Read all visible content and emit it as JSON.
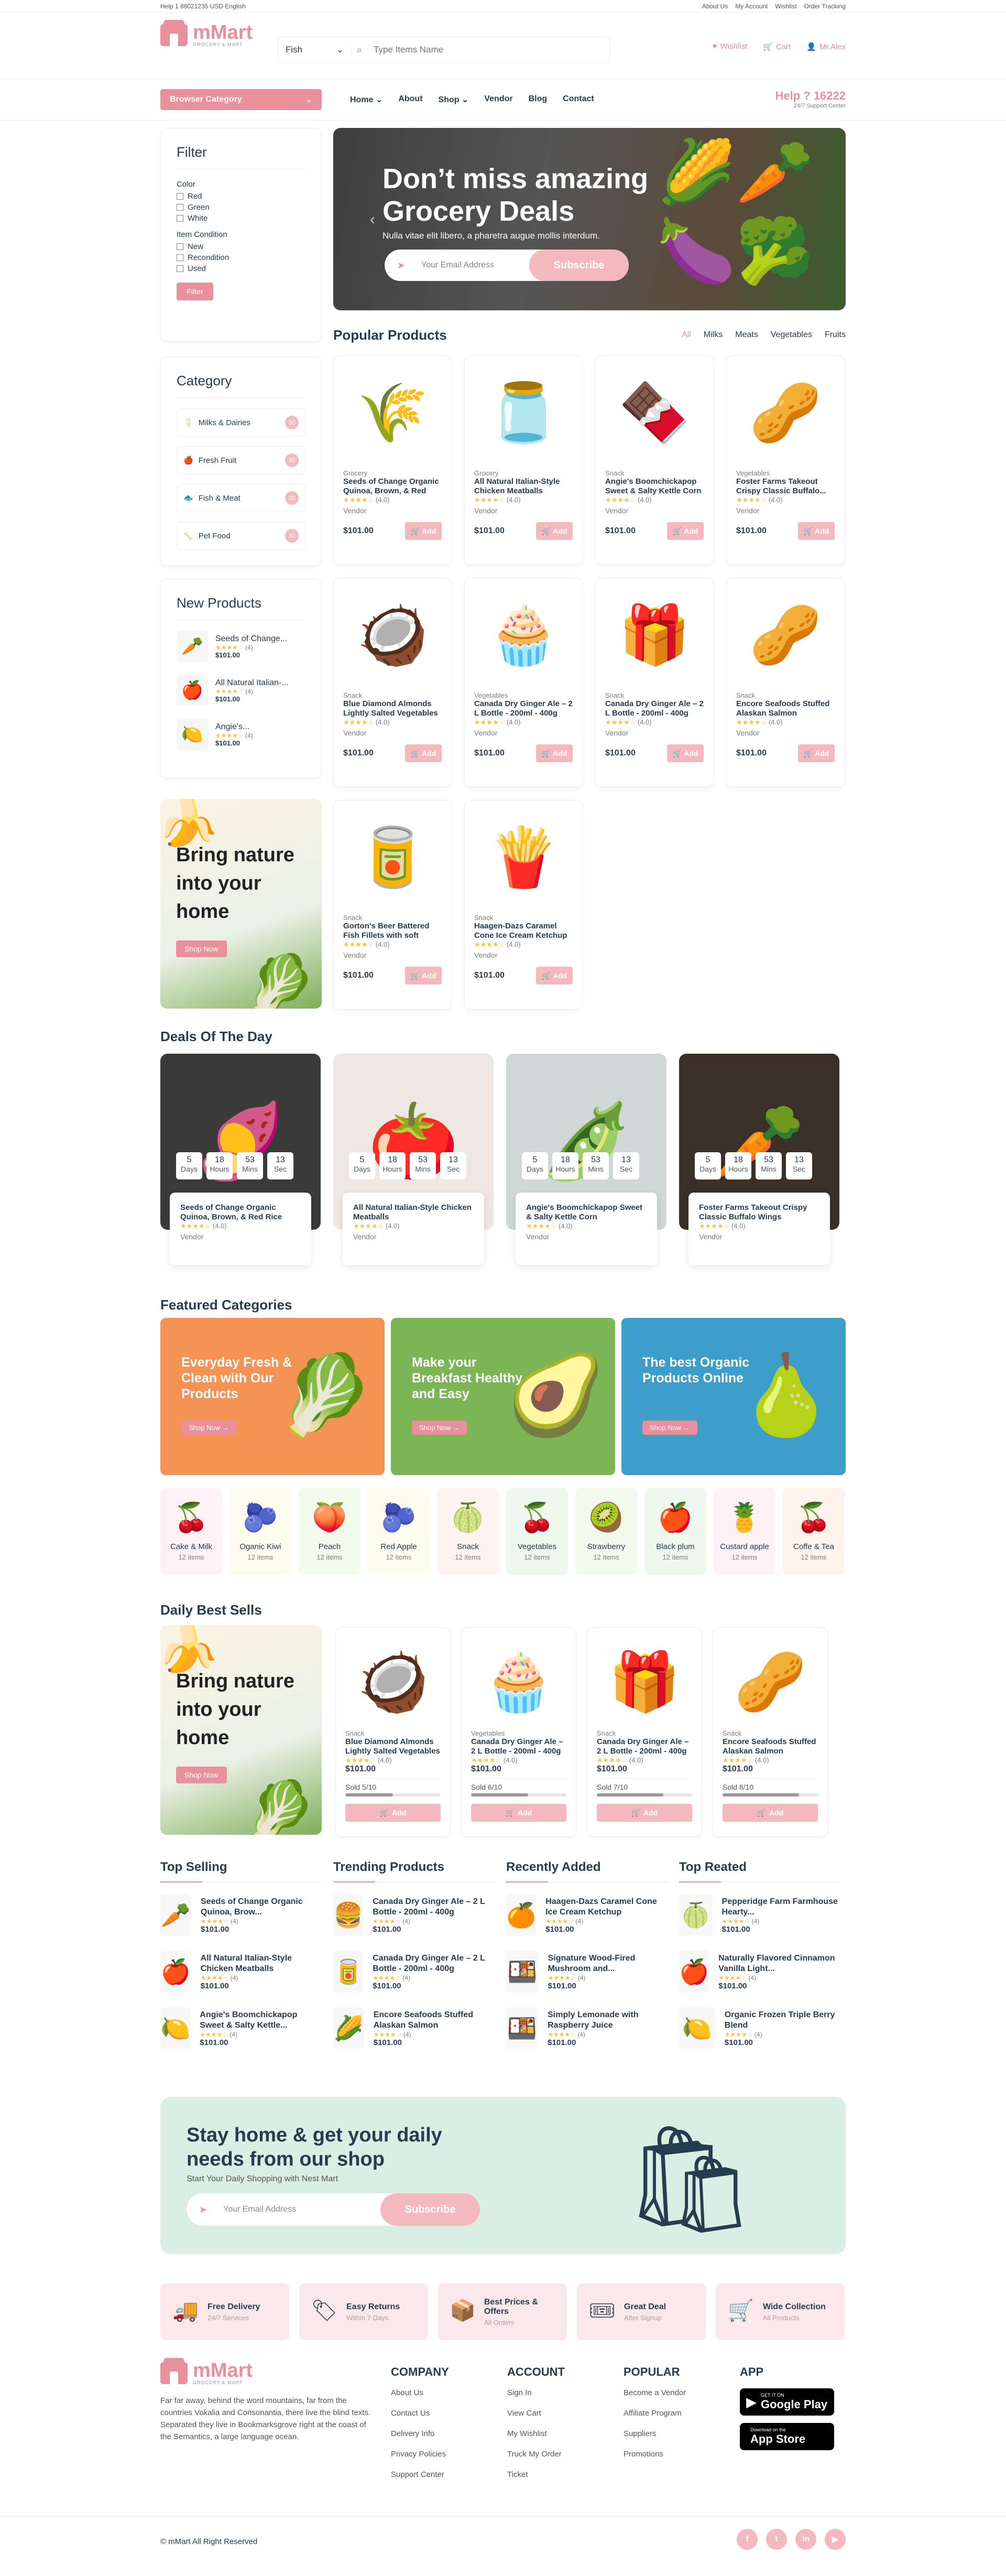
{
  "topbar": {
    "left": "Help 1 88021235  USD  English",
    "links": [
      "About Us",
      "My Account",
      "Wishlist",
      "Order Tracking"
    ]
  },
  "header": {
    "logo": "mMart",
    "logo_sub": "GROCERY & MART",
    "search_cat": "Fish",
    "search_placeholder": "Type Items Name",
    "wishlist": "Wishlist",
    "cart": "Cart",
    "account": "Mr.Alex"
  },
  "nav": {
    "browse": "Browser Category",
    "items": [
      "Home",
      "About",
      "Shop",
      "Vendor",
      "Blog",
      "Contact"
    ],
    "help_num": "Help ? 16222",
    "help_sub": "24/7 Support Center"
  },
  "filter": {
    "title": "Filter",
    "color_label": "Color",
    "colors": [
      "Red",
      "Green",
      "White"
    ],
    "cond_label": "Item Condition",
    "conds": [
      "New",
      "Recondition",
      "Used"
    ],
    "btn": "Filter"
  },
  "category": {
    "title": "Category",
    "items": [
      {
        "name": "Milks & Dairies",
        "count": "30",
        "icon": "🥛"
      },
      {
        "name": "Fresh Fruit",
        "count": "30",
        "icon": "🍎"
      },
      {
        "name": "Fish & Meat",
        "count": "30",
        "icon": "🐟"
      },
      {
        "name": "Pet Food",
        "count": "30",
        "icon": "🦴"
      }
    ]
  },
  "newp": {
    "title": "New Products",
    "items": [
      {
        "name": "Seeds of Change...",
        "rating": "(4)",
        "price": "$101.00",
        "icon": "🥕"
      },
      {
        "name": "All Natural Italian-...",
        "rating": "(4)",
        "price": "$101.00",
        "icon": "🍎"
      },
      {
        "name": "Angie's...",
        "rating": "(4)",
        "price": "$101.00",
        "icon": "🍋"
      }
    ]
  },
  "bannerL": {
    "title": "Bring nature into your home",
    "btn": "Shop Now"
  },
  "hero": {
    "title": "Don’t miss amazing Grocery Deals",
    "sub": "Nulla vitae elit libero, a pharetra augue mollis interdum.",
    "placeholder": "Your Email Address",
    "btn": "Subscribe"
  },
  "popular": {
    "title": "Popular Products",
    "tabs": [
      "All",
      "Milks",
      "Meats",
      "Vegetables",
      "Fruits"
    ],
    "items": [
      {
        "cat": "Grocery",
        "name": "Seeds of Change Organic Quinoa, Brown, & Red Rice",
        "rating": "(4.0)",
        "vendor": "Vendor",
        "price": "$101.00",
        "icon": "🌾"
      },
      {
        "cat": "Grocery",
        "name": "All Natural Italian-Style Chicken Meatballs",
        "rating": "(4.0)",
        "vendor": "Vendor",
        "price": "$101.00",
        "icon": "🫙"
      },
      {
        "cat": "Snack",
        "name": "Angie's Boomchickapop Sweet & Salty Kettle Corn",
        "rating": "(4.0)",
        "vendor": "Vendor",
        "price": "$101.00",
        "icon": "🍫"
      },
      {
        "cat": "Vegetables",
        "name": "Foster Farms Takeout Crispy Classic Buffalo...",
        "rating": "(4.0)",
        "vendor": "Vendor",
        "price": "$101.00",
        "icon": "🥜"
      },
      {
        "cat": "Snack",
        "name": "Blue Diamond Almonds Lightly Salted Vegetables",
        "rating": "(4.0)",
        "vendor": "Vendor",
        "price": "$101.00",
        "icon": "🥥"
      },
      {
        "cat": "Vegetables",
        "name": "Canada Dry Ginger Ale – 2 L Bottle - 200ml - 400g",
        "rating": "(4.0)",
        "vendor": "Vendor",
        "price": "$101.00",
        "icon": "🧁"
      },
      {
        "cat": "Snack",
        "name": "Canada Dry Ginger Ale – 2 L Bottle - 200ml - 400g",
        "rating": "(4.0)",
        "vendor": "Vendor",
        "price": "$101.00",
        "icon": "🎁"
      },
      {
        "cat": "Snack",
        "name": "Encore Seafoods Stuffed Alaskan Salmon",
        "rating": "(4.0)",
        "vendor": "Vendor",
        "price": "$101.00",
        "icon": "🥜"
      },
      {
        "cat": "Snack",
        "name": "Gorton's Beer Battered Fish Fillets with soft paper",
        "rating": "(4.0)",
        "vendor": "Vendor",
        "price": "$101.00",
        "icon": "🥫"
      },
      {
        "cat": "Snack",
        "name": "Haagen-Dazs Caramel Cone Ice Cream Ketchup",
        "rating": "(4.0)",
        "vendor": "Vendor",
        "price": "$101.00",
        "icon": "🍟"
      }
    ],
    "add": "Add"
  },
  "deals": {
    "title": "Deals Of The Day",
    "timer": [
      {
        "v": "5",
        "u": "Days"
      },
      {
        "v": "18",
        "u": "Hours"
      },
      {
        "v": "53",
        "u": "Mins"
      },
      {
        "v": "13",
        "u": "Sec"
      }
    ],
    "items": [
      {
        "name": "Seeds of Change Organic Quinoa, Brown, & Red Rice",
        "rating": "(4.0)",
        "vendor": "Vendor",
        "icon": "🍠",
        "bg": "#3a3a3a"
      },
      {
        "name": "All Natural Italian-Style Chicken Meatballs",
        "rating": "(4.0)",
        "vendor": "Vendor",
        "icon": "🍅",
        "bg": "#eee7e2"
      },
      {
        "name": "Angie's Boomchickapop Sweet & Salty Kettle Corn",
        "rating": "(4.0)",
        "vendor": "Vendor",
        "icon": "🫛",
        "bg": "#cfd8d6"
      },
      {
        "name": "Foster Farms Takeout Crispy Classic Buffalo Wings",
        "rating": "(4.0)",
        "vendor": "Vendor",
        "icon": "🥕",
        "bg": "#3b3028"
      }
    ]
  },
  "featured": {
    "title": "Featured Categories",
    "banners": [
      {
        "title": "Everyday Fresh & Clean with Our Products",
        "btn": "Shop Now →",
        "bg": "#f49353",
        "icon": "🥬"
      },
      {
        "title": "Make your Breakfast Healthy and Easy",
        "btn": "Shop Now →",
        "bg": "#7bb555",
        "icon": "🥑"
      },
      {
        "title": "The best Organic Products Online",
        "btn": "Shop Now →",
        "bg": "#3d9ec9",
        "icon": "🍐"
      }
    ],
    "cats": [
      {
        "n": "Cake & Milk",
        "c": "12 items",
        "e": "🍒",
        "bg": "#fdf1f6"
      },
      {
        "n": "Oganic Kiwi",
        "c": "12 items",
        "e": "🫐",
        "bg": "#fdfbee"
      },
      {
        "n": "Peach",
        "c": "12 items",
        "e": "🍑",
        "bg": "#f2fbec"
      },
      {
        "n": "Red Apple",
        "c": "12 items",
        "e": "🫐",
        "bg": "#fefbef"
      },
      {
        "n": "Snack",
        "c": "12 items",
        "e": "🍈",
        "bg": "#fdf3f0"
      },
      {
        "n": "Vegetables",
        "c": "12 items",
        "e": "🍒",
        "bg": "#eef8ee"
      },
      {
        "n": "Strawberry",
        "c": "12 items",
        "e": "🥝",
        "bg": "#f2faec"
      },
      {
        "n": "Black plum",
        "c": "12 items",
        "e": "🍎",
        "bg": "#eef8ee"
      },
      {
        "n": "Custard apple",
        "c": "12 items",
        "e": "🍍",
        "bg": "#fdf1f6"
      },
      {
        "n": "Coffe & Tea",
        "c": "12 items",
        "e": "🍒",
        "bg": "#fef3ea"
      }
    ]
  },
  "daily": {
    "title": "Daily Best Sells",
    "banner_title": "Bring nature into your home",
    "banner_btn": "Shop Now",
    "items": [
      {
        "cat": "Snack",
        "name": "Blue Diamond Almonds Lightly Salted Vegetables",
        "rating": "(4.0)",
        "price": "$101.00",
        "sold": "Sold 5/10",
        "pct": 0.5,
        "icon": "🥥"
      },
      {
        "cat": "Vegetables",
        "name": "Canada Dry Ginger Ale – 2 L Bottle - 200ml - 400g",
        "rating": "(4.0)",
        "price": "$101.00",
        "sold": "Sold 6/10",
        "pct": 0.6,
        "icon": "🧁"
      },
      {
        "cat": "Snack",
        "name": "Canada Dry Ginger Ale – 2 L Bottle - 200ml - 400g",
        "rating": "(4.0)",
        "price": "$101.00",
        "sold": "Sold 7/10",
        "pct": 0.7,
        "icon": "🎁"
      },
      {
        "cat": "Snack",
        "name": "Encore Seafoods Stuffed Alaskan Salmon",
        "rating": "(4.0)",
        "price": "$101.00",
        "sold": "Sold 8/10",
        "pct": 0.8,
        "icon": "🥜"
      }
    ],
    "add": "Add"
  },
  "lists": [
    {
      "title": "Top Selling",
      "items": [
        {
          "name": "Seeds of Change Organic Quinoa, Brow...",
          "r": "(4)",
          "p": "$101.00",
          "e": "🥕"
        },
        {
          "name": "All Natural Italian-Style Chicken Meatballs",
          "r": "(4)",
          "p": "$101.00",
          "e": "🍎"
        },
        {
          "name": "Angie's Boomchickapop Sweet & Salty Kettle...",
          "r": "(4)",
          "p": "$101.00",
          "e": "🍋"
        }
      ]
    },
    {
      "title": "Trending Products",
      "items": [
        {
          "name": "Canada Dry Ginger Ale – 2 L Bottle - 200ml - 400g",
          "r": "(4)",
          "p": "$101.00",
          "e": "🍔"
        },
        {
          "name": "Canada Dry Ginger Ale – 2 L Bottle - 200ml - 400g",
          "r": "(4)",
          "p": "$101.00",
          "e": "🥫"
        },
        {
          "name": "Encore Seafoods Stuffed Alaskan Salmon",
          "r": "(4)",
          "p": "$101.00",
          "e": "🌽"
        }
      ]
    },
    {
      "title": "Recently Added",
      "items": [
        {
          "name": "Haagen-Dazs Caramel Cone Ice Cream Ketchup",
          "r": "(4)",
          "p": "$101.00",
          "e": "🍊"
        },
        {
          "name": "Signature Wood-Fired Mushroom and...",
          "r": "(4)",
          "p": "$101.00",
          "e": "🍱"
        },
        {
          "name": "Simply Lemonade with Raspberry Juice",
          "r": "(4)",
          "p": "$101.00",
          "e": "🍱"
        }
      ]
    },
    {
      "title": "Top Reated",
      "items": [
        {
          "name": "Pepperidge Farm Farmhouse Hearty...",
          "r": "(4)",
          "p": "$101.00",
          "e": "🍈"
        },
        {
          "name": "Naturally Flavored Cinnamon Vanilla Light...",
          "r": "(4)",
          "p": "$101.00",
          "e": "🍎"
        },
        {
          "name": "Organic Frozen Triple Berry Blend",
          "r": "(4)",
          "p": "$101.00",
          "e": "🍋"
        }
      ]
    }
  ],
  "newsletter": {
    "title": "Stay home & get your daily needs from our shop",
    "sub": "Start Your Daily Shopping with Nest Mart",
    "placeholder": "Your Email Address",
    "btn": "Subscribe"
  },
  "features": [
    {
      "t": "Free Delivery",
      "s": "24/7 Services",
      "e": "🚚"
    },
    {
      "t": "Easy Returns",
      "s": "Within 7 Days",
      "e": "🏷"
    },
    {
      "t": "Best Prices & Offers",
      "s": "All Orders",
      "e": "📦"
    },
    {
      "t": "Great Deal",
      "s": "After Signup",
      "e": "🎟"
    },
    {
      "t": "Wide Collection",
      "s": "All Products",
      "e": "🛒"
    }
  ],
  "footer": {
    "about": "Far far away, behind the word mountains, far from the countries Vokalia and Consonantia, there live the blind texts. Separated they live in Bookmarksgrove right at the coast of the Semantics, a large language ocean.",
    "cols": [
      {
        "h": "COMPANY",
        "l": [
          "About Us",
          "Contact Us",
          "Delivery Info",
          "Privacy Policies",
          "Support Center"
        ]
      },
      {
        "h": "ACCOUNT",
        "l": [
          "Sign In",
          "View Cart",
          "My Wishlist",
          "Truck My Order",
          "Ticket"
        ]
      },
      {
        "h": "POPULAR",
        "l": [
          "Become a Vendor",
          "Affiliate Program",
          "Suppliers",
          "Promotions"
        ]
      }
    ],
    "app": "APP",
    "gp_small": "GET IT ON",
    "gp": "Google Play",
    "as_small": "Download on the",
    "as": "App Store",
    "copy": "© mMart All Right Reserved",
    "social": [
      "f",
      "t",
      "in",
      "▶"
    ]
  }
}
